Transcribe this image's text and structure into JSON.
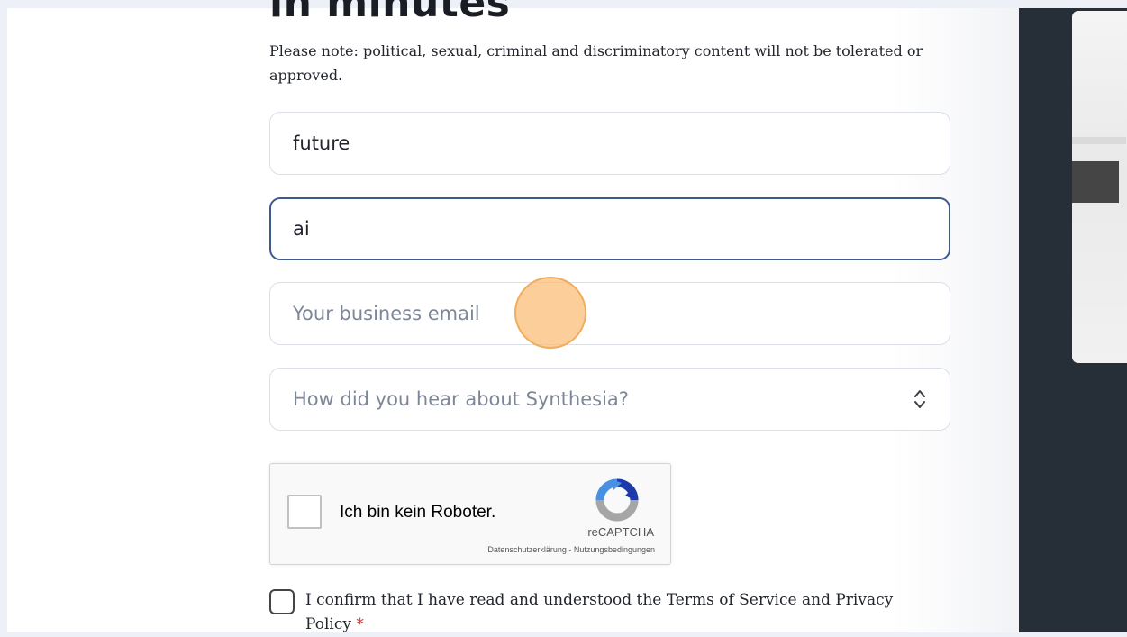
{
  "form": {
    "heading": "in minutes",
    "note": "Please note: political, sexual, criminal and discriminatory content will not be tolerated or approved.",
    "first_field_value": "future",
    "second_field_value": "ai",
    "email_placeholder": "Your business email",
    "source_select_placeholder": "How did you hear about Synthesia?"
  },
  "recaptcha": {
    "label": "Ich bin kein Roboter.",
    "brand": "reCAPTCHA",
    "links": "Datenschutzerklärung - Nutzungsbedingungen"
  },
  "consent": {
    "text": "I confirm that I have read and understood the Terms of Service and Privacy Policy",
    "required_mark": "*"
  },
  "colors": {
    "focus_border": "#3f5a8c",
    "sidebar": "#262e38",
    "cursor_highlight": "#fabe78"
  }
}
